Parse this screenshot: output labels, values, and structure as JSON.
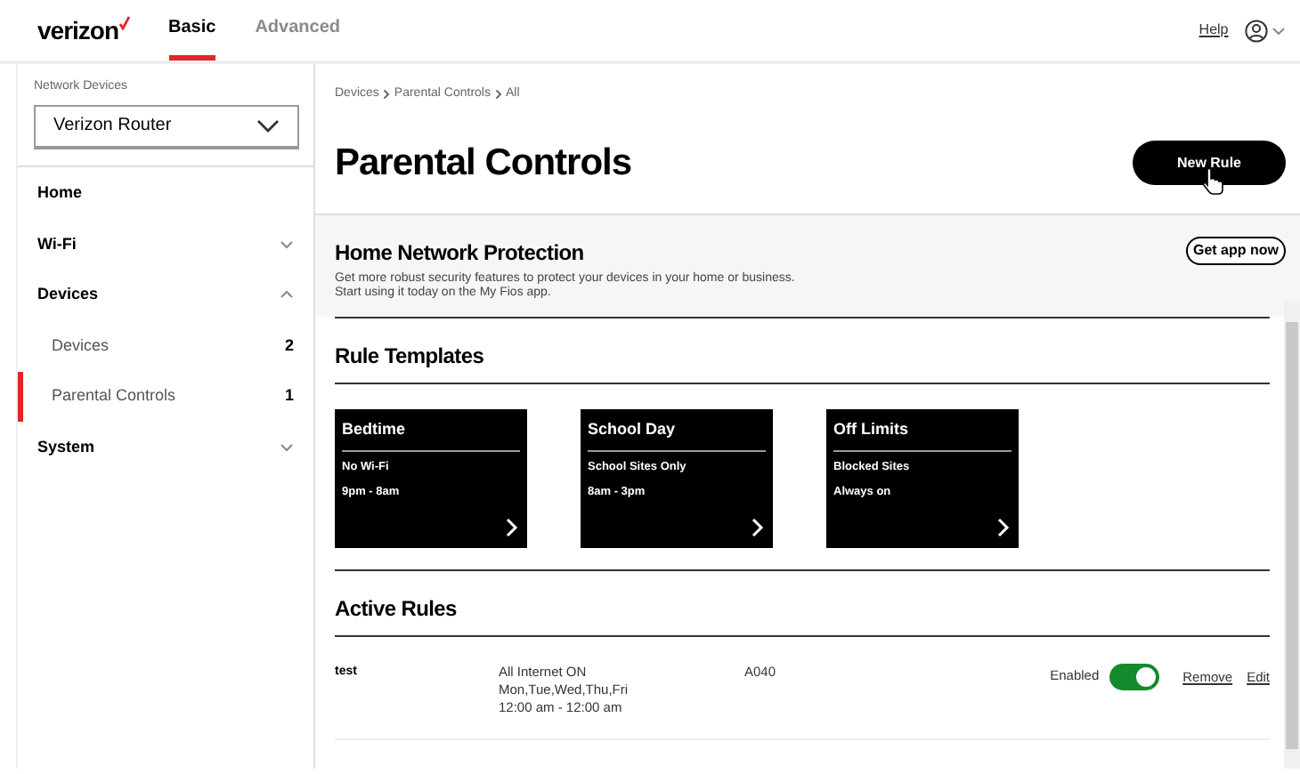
{
  "header": {
    "logo": "verizon",
    "tabs": [
      {
        "label": "Basic",
        "selected": true
      },
      {
        "label": "Advanced",
        "selected": false
      }
    ],
    "help": "Help"
  },
  "sidebar": {
    "device_label": "Network Devices",
    "device_value": "Verizon Router",
    "items": [
      {
        "label": "Home"
      },
      {
        "label": "Wi-Fi",
        "expanded": false
      },
      {
        "label": "Devices",
        "expanded": true,
        "children": [
          {
            "label": "Devices",
            "count": "2",
            "selected": false
          },
          {
            "label": "Parental Controls",
            "count": "1",
            "selected": true
          }
        ]
      },
      {
        "label": "System",
        "expanded": false
      }
    ]
  },
  "breadcrumb": [
    "Devices",
    "Parental Controls",
    "All"
  ],
  "title": "Parental Controls",
  "new_rule_button": "New Rule",
  "promo": {
    "title": "Home Network Protection",
    "text": "Get more robust security features to protect your devices in your home or business.\nStart using it today on the My Fios app.",
    "button": "Get app now"
  },
  "templates_title": "Rule Templates",
  "templates": [
    {
      "title": "Bedtime",
      "lines": [
        "No Wi-Fi",
        "9pm - 8am"
      ]
    },
    {
      "title": "School Day",
      "lines": [
        "School Sites Only",
        "8am - 3pm"
      ]
    },
    {
      "title": "Off Limits",
      "lines": [
        "Blocked Sites",
        "Always on"
      ]
    }
  ],
  "active_title": "Active Rules",
  "rules": [
    {
      "name": "test",
      "schedule": [
        "All Internet ON",
        "Mon,Tue,Wed,Thu,Fri",
        "12:00 am - 12:00 am"
      ],
      "device": "A040",
      "status": "Enabled",
      "on": true,
      "actions": [
        "Remove",
        "Edit"
      ]
    }
  ]
}
